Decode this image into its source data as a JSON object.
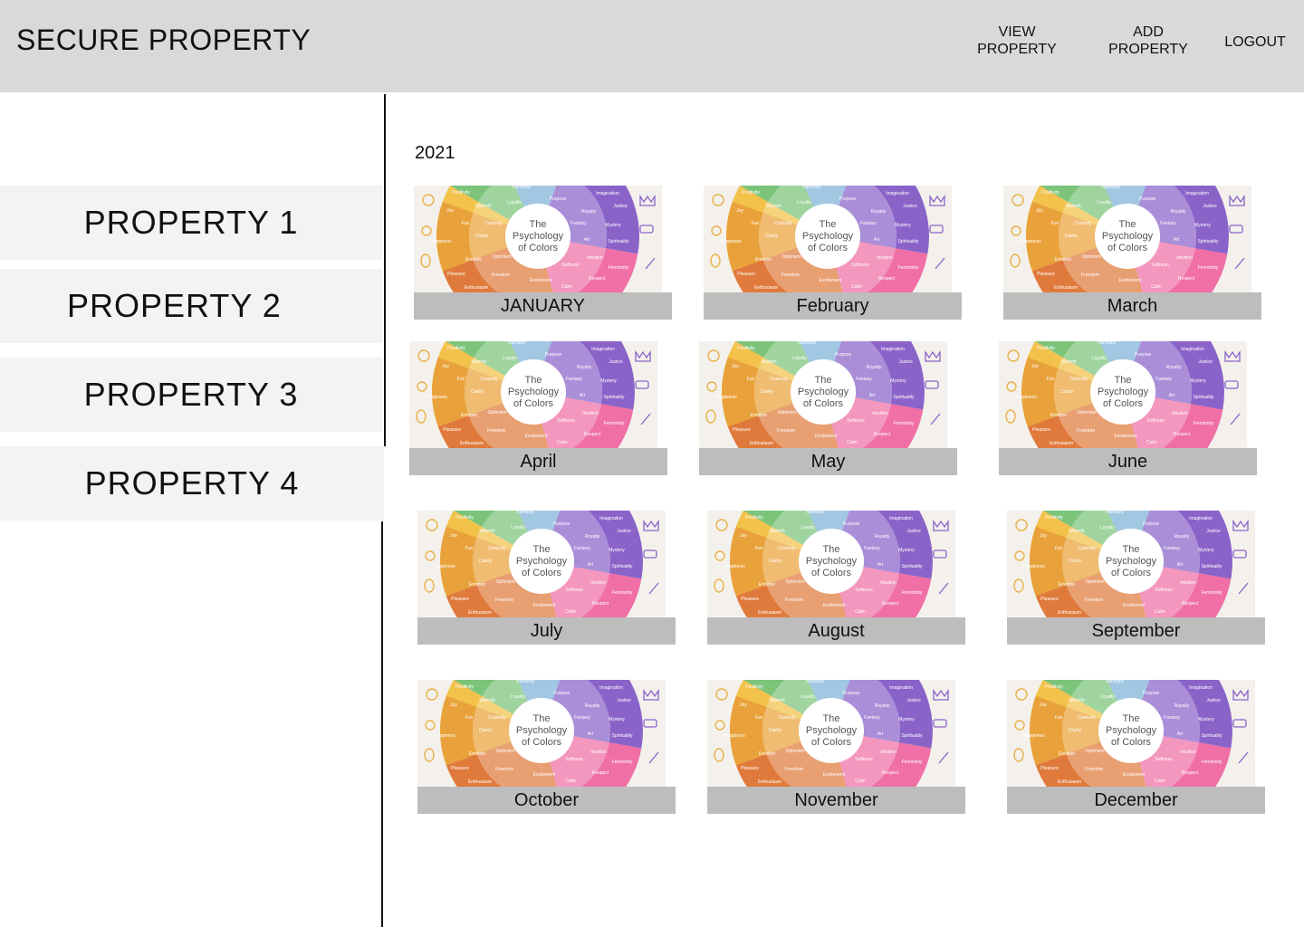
{
  "header": {
    "brand": "SECURE PROPERTY",
    "nav": {
      "view_property_line1": "VIEW",
      "view_property_line2": "PROPERTY",
      "add_property_line1": "ADD",
      "add_property_line2": "PROPERTY",
      "logout": "LOGOUT"
    }
  },
  "sidebar": {
    "properties": [
      "PROPERTY 1",
      "PROPERTY 2",
      "PROPERTY 3",
      "PROPERTY 4"
    ]
  },
  "main": {
    "year": "2021",
    "months": [
      "JANUARY",
      "February",
      "March",
      "April",
      "May",
      "June",
      "July",
      "August",
      "September",
      "October",
      "November",
      "December"
    ],
    "thumbnail": {
      "title_line1": "The",
      "title_line2": "Psychology",
      "title_line3": "of Colors",
      "words": [
        "Positivity",
        "Harmony",
        "Imagination",
        "Joy",
        "Warmth",
        "Loyalty",
        "Purpose",
        "Royalty",
        "Justice",
        "Fun",
        "Curiosity",
        "Fantasy",
        "Mystery",
        "Happiness",
        "Clarity",
        "Art",
        "Spirituality",
        "Emotion",
        "Optimism",
        "Intuition",
        "Softness",
        "Femininity",
        "Pleasure",
        "Freedom",
        "Excitement",
        "Respect",
        "Enthusiasm",
        "Calm"
      ],
      "colors": {
        "orange": "#e9a23b",
        "yellow": "#f2c24b",
        "green": "#7cc47a",
        "blue": "#7fb2d8",
        "purple": "#8a63c9",
        "pink": "#ef6fa6",
        "deep_orange": "#e07a3c",
        "background": "#f4f1ec",
        "label_bar": "#bdbdbd"
      }
    }
  },
  "colors": {
    "header_bg": "#d9d9d9",
    "sidebar_item_bg": "#f3f3f3"
  }
}
